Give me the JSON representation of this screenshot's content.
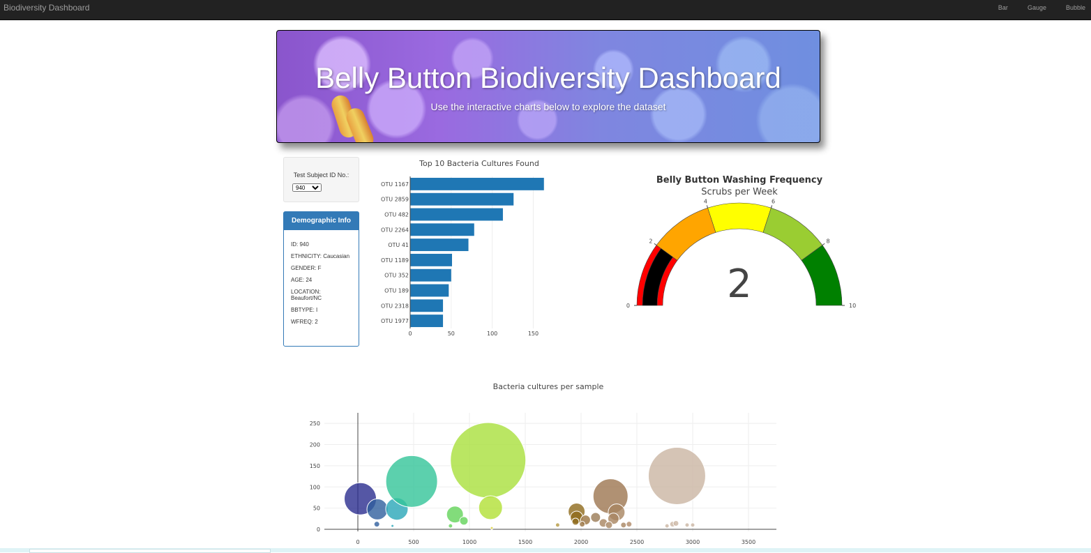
{
  "navbar": {
    "brand": "Biodiversity Dashboard",
    "links": [
      "Bar",
      "Gauge",
      "Bubble"
    ]
  },
  "header": {
    "title": "Belly Button Biodiversity Dashboard",
    "subtitle": "Use the interactive charts below to explore the dataset"
  },
  "selector": {
    "label": "Test Subject ID No.:",
    "selected": "940"
  },
  "demographics": {
    "heading": "Demographic Info",
    "lines": [
      "ID: 940",
      "ETHNICITY: Caucasian",
      "GENDER: F",
      "AGE: 24",
      "LOCATION: Beaufort/NC",
      "BBTYPE: I",
      "WFREQ: 2"
    ]
  },
  "colors": {
    "bar": "#1f77b4",
    "navbar": "#222222",
    "panel": "#337ab7"
  },
  "chart_data": [
    {
      "type": "bar",
      "orientation": "horizontal",
      "title": "Top 10 Bacteria Cultures Found",
      "categories": [
        "OTU 1167",
        "OTU 2859",
        "OTU 482",
        "OTU 2264",
        "OTU 41",
        "OTU 1189",
        "OTU 352",
        "OTU 189",
        "OTU 2318",
        "OTU 1977"
      ],
      "values": [
        163,
        126,
        113,
        78,
        71,
        51,
        50,
        47,
        40,
        40
      ],
      "xlim": [
        0,
        170
      ],
      "xticks": [
        0,
        50,
        100,
        150
      ]
    },
    {
      "type": "gauge",
      "title": "Belly Button Washing Frequency",
      "subtitle": "Scrubs per Week",
      "value": 2,
      "range": [
        0,
        10
      ],
      "ticks": [
        0,
        2,
        4,
        6,
        8,
        10
      ],
      "bands": [
        {
          "from": 0,
          "to": 2,
          "color": "#ff0000"
        },
        {
          "from": 2,
          "to": 4,
          "color": "#ffa500"
        },
        {
          "from": 4,
          "to": 6,
          "color": "#ffff00"
        },
        {
          "from": 6,
          "to": 8,
          "color": "#9acd32"
        },
        {
          "from": 8,
          "to": 10,
          "color": "#008000"
        }
      ],
      "bar_color": "#000000"
    },
    {
      "type": "scatter",
      "title": "Bacteria cultures per sample",
      "xlim": [
        -300,
        3750
      ],
      "ylim": [
        -5,
        275
      ],
      "xticks": [
        0,
        500,
        1000,
        1500,
        2000,
        2500,
        3000,
        3500
      ],
      "yticks": [
        0,
        50,
        100,
        150,
        200,
        250
      ],
      "points": [
        {
          "x": 22,
          "y": 72,
          "r": 23,
          "color": "#2a2d8f"
        },
        {
          "x": 175,
          "y": 47,
          "r": 15,
          "color": "#2f5f9e"
        },
        {
          "x": 170,
          "y": 12,
          "r": 4,
          "color": "#2f5f9e"
        },
        {
          "x": 350,
          "y": 48,
          "r": 16,
          "color": "#29a6b8"
        },
        {
          "x": 482,
          "y": 113,
          "r": 37,
          "color": "#33c498"
        },
        {
          "x": 310,
          "y": 8,
          "r": 2,
          "color": "#29a6b8"
        },
        {
          "x": 870,
          "y": 35,
          "r": 12,
          "color": "#63d35a"
        },
        {
          "x": 950,
          "y": 20,
          "r": 6,
          "color": "#63d35a"
        },
        {
          "x": 830,
          "y": 8,
          "r": 3,
          "color": "#63d35a"
        },
        {
          "x": 1167,
          "y": 163,
          "r": 54,
          "color": "#a9e03c"
        },
        {
          "x": 1189,
          "y": 51,
          "r": 17,
          "color": "#b2e034"
        },
        {
          "x": 1200,
          "y": 3,
          "r": 2,
          "color": "#d9d03a"
        },
        {
          "x": 1790,
          "y": 10,
          "r": 3,
          "color": "#b79a40"
        },
        {
          "x": 1960,
          "y": 42,
          "r": 12,
          "color": "#8e6a1b"
        },
        {
          "x": 1960,
          "y": 28,
          "r": 9,
          "color": "#8e6a1b"
        },
        {
          "x": 1950,
          "y": 18,
          "r": 5,
          "color": "#8e6a1b"
        },
        {
          "x": 2040,
          "y": 22,
          "r": 7,
          "color": "#9a7340"
        },
        {
          "x": 2010,
          "y": 12,
          "r": 4,
          "color": "#9a7340"
        },
        {
          "x": 2130,
          "y": 28,
          "r": 7,
          "color": "#9a7a55"
        },
        {
          "x": 2264,
          "y": 78,
          "r": 25,
          "color": "#9c7650"
        },
        {
          "x": 2318,
          "y": 40,
          "r": 12,
          "color": "#a88460"
        },
        {
          "x": 2290,
          "y": 25,
          "r": 8,
          "color": "#a88460"
        },
        {
          "x": 2200,
          "y": 15,
          "r": 6,
          "color": "#a88460"
        },
        {
          "x": 2250,
          "y": 10,
          "r": 5,
          "color": "#a88460"
        },
        {
          "x": 2380,
          "y": 10,
          "r": 4,
          "color": "#a88460"
        },
        {
          "x": 2430,
          "y": 12,
          "r": 4,
          "color": "#b08a68"
        },
        {
          "x": 2859,
          "y": 126,
          "r": 41,
          "color": "#cbb5a2"
        },
        {
          "x": 2770,
          "y": 8,
          "r": 3,
          "color": "#cbb5a2"
        },
        {
          "x": 2820,
          "y": 12,
          "r": 4,
          "color": "#cbb5a2"
        },
        {
          "x": 2850,
          "y": 14,
          "r": 4,
          "color": "#cbb5a2"
        },
        {
          "x": 2950,
          "y": 10,
          "r": 3,
          "color": "#cbb5a2"
        },
        {
          "x": 3000,
          "y": 10,
          "r": 3,
          "color": "#cbb5a2"
        }
      ]
    }
  ]
}
